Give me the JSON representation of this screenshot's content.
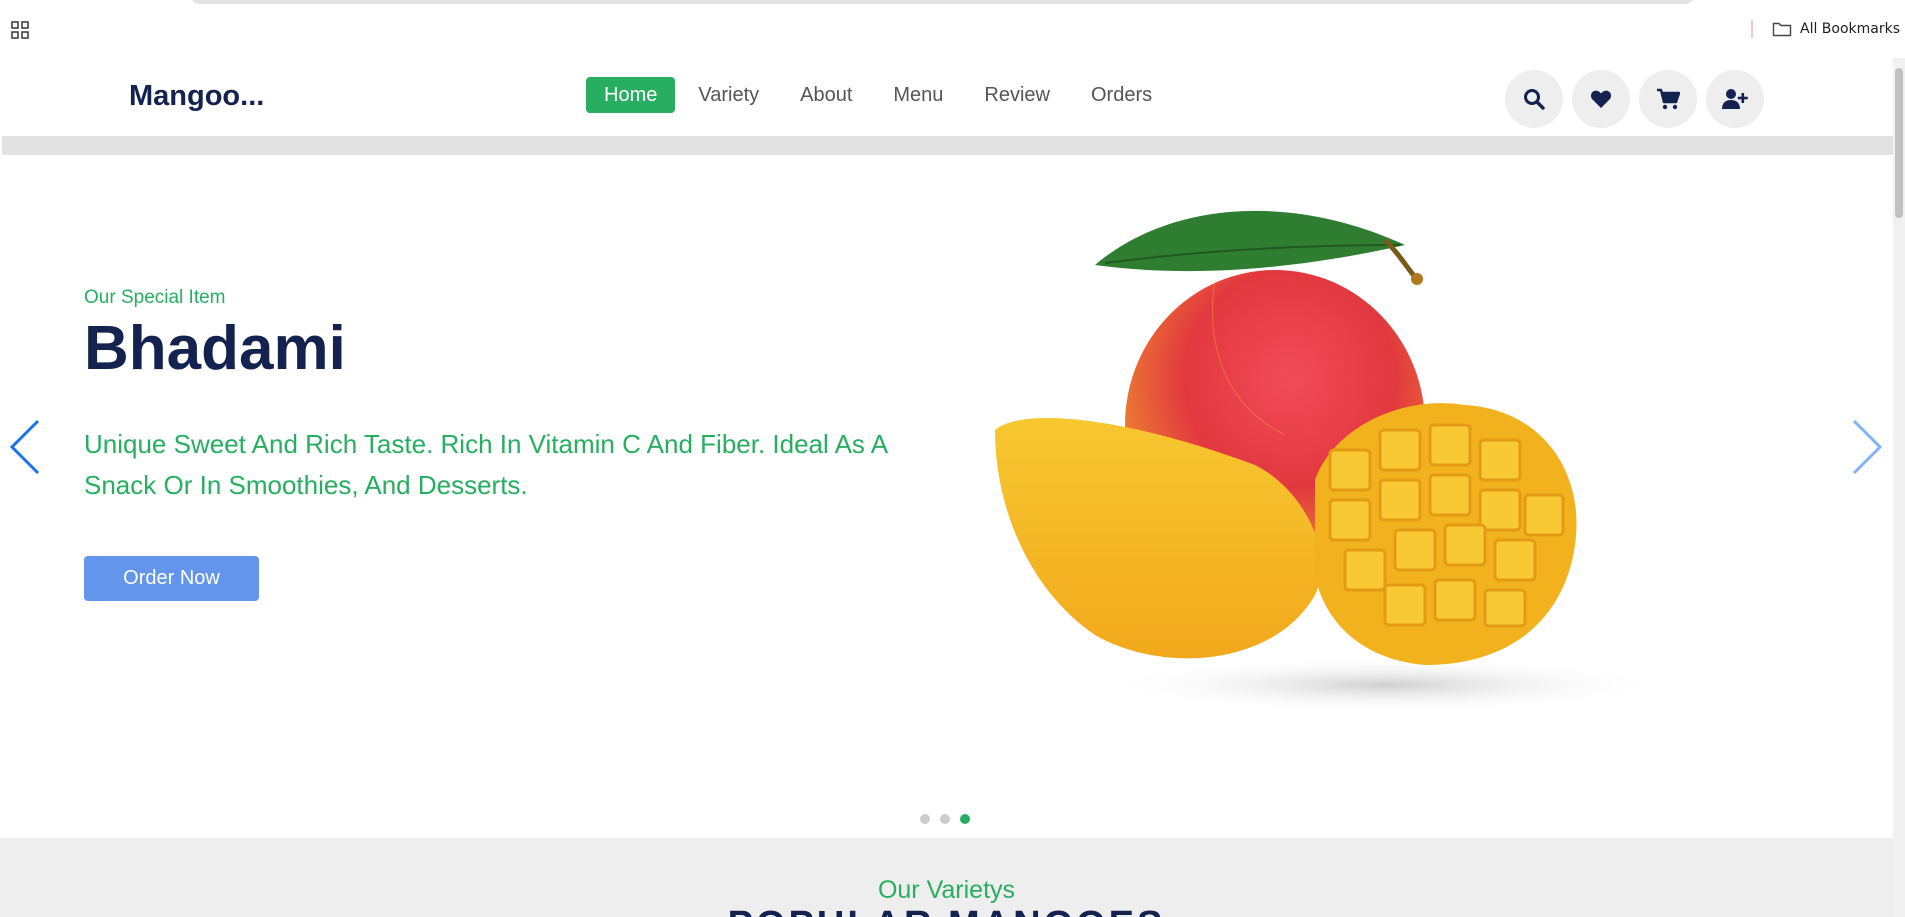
{
  "browser": {
    "apps_icon": "apps-grid-icon",
    "all_bookmarks_label": "All Bookmarks",
    "folder_icon": "folder-icon"
  },
  "header": {
    "logo": "Mangoo...",
    "nav": [
      {
        "label": "Home",
        "active": true
      },
      {
        "label": "Variety",
        "active": false
      },
      {
        "label": "About",
        "active": false
      },
      {
        "label": "Menu",
        "active": false
      },
      {
        "label": "Review",
        "active": false
      },
      {
        "label": "Orders",
        "active": false
      }
    ],
    "icons": [
      "search-icon",
      "heart-icon",
      "cart-icon",
      "user-plus-icon"
    ]
  },
  "hero": {
    "subtitle": "Our Special Item",
    "title": "Bhadami",
    "description": "Unique Sweet And Rich Taste. Rich In Vitamin C And Fiber. Ideal As A Snack Or In Smoothies, And Desserts.",
    "button_label": "Order Now",
    "slides_total": 3,
    "active_slide": 3
  },
  "varieties": {
    "subtitle": "Our Varietys",
    "title": "POPULAR MANGOES"
  },
  "colors": {
    "brand_dark": "#13224f",
    "accent_green": "#27ae60",
    "button_blue": "#6495ed",
    "arrow_blue": "#1a73e8"
  }
}
